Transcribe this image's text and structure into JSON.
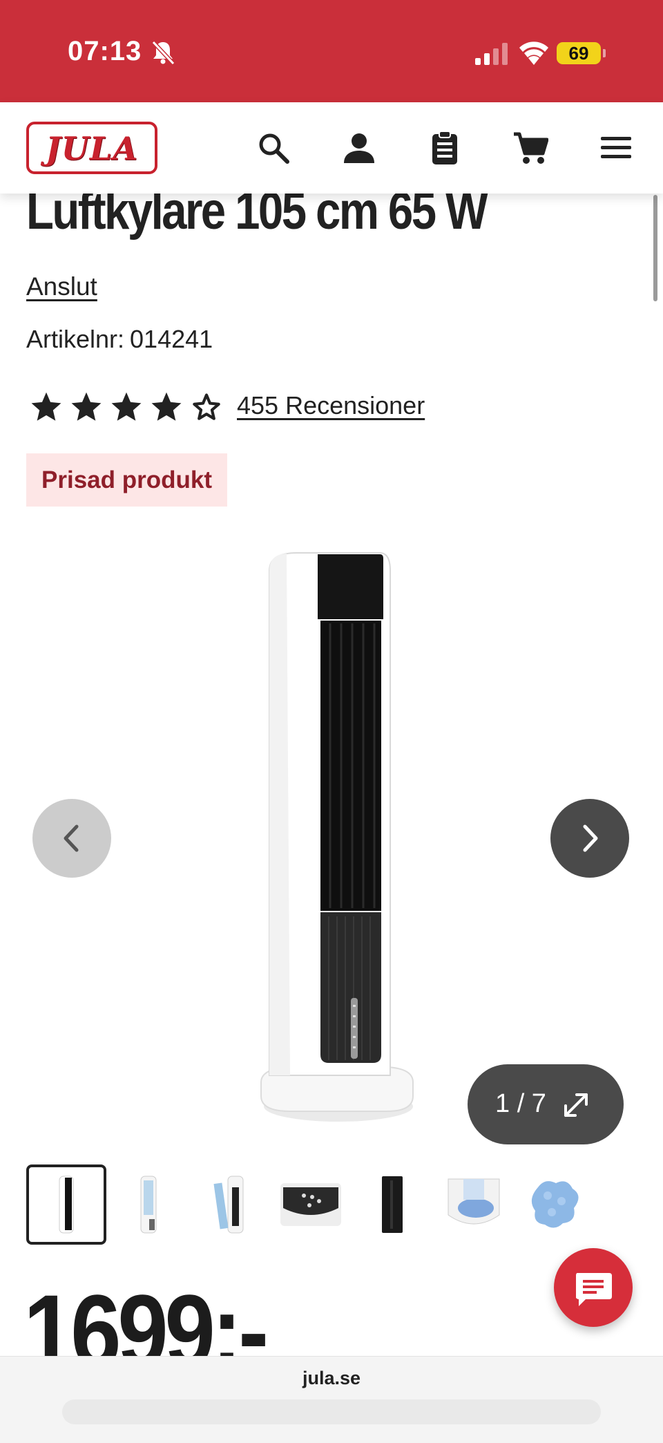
{
  "status_bar": {
    "time": "07:13",
    "battery_level": "69",
    "icons": [
      "bell-slash-icon",
      "cellular-signal-icon",
      "wifi-icon",
      "battery-icon"
    ]
  },
  "nav": {
    "logo_text": "JULA",
    "icons": [
      "search-icon",
      "account-icon",
      "shopping-list-icon",
      "cart-icon",
      "menu-icon"
    ]
  },
  "product": {
    "title": "Luftkylare 105 cm 65 W",
    "brand_link": "Anslut",
    "article_label": "Artikelnr:",
    "article_number": "014241",
    "rating": 4,
    "rating_max": 5,
    "reviews_link": "455 Recensioner",
    "badge": "Prisad produkt",
    "price": "1699:-"
  },
  "gallery": {
    "counter": "1 / 7",
    "current": 1,
    "total": 7,
    "thumbnails": [
      "front-view",
      "side-view",
      "filter-view",
      "control-panel",
      "back-view",
      "water-tank",
      "ice-packs"
    ]
  },
  "browser": {
    "url": "jula.se"
  },
  "colors": {
    "brand_red": "#ca2f3a",
    "badge_bg": "#fde6e6",
    "badge_text": "#8f1f2a",
    "battery_yellow": "#f2d31a"
  }
}
